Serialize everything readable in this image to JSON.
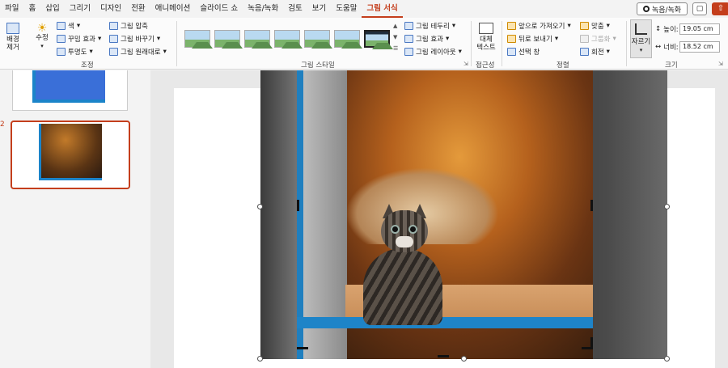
{
  "menu": {
    "items": [
      "파일",
      "홈",
      "삽입",
      "그리기",
      "디자인",
      "전환",
      "애니메이션",
      "슬라이드 쇼",
      "녹음/녹화",
      "검토",
      "보기",
      "도움말",
      "그림 서식"
    ],
    "record_button": "녹음/녹화",
    "accent_color": "#c43e1c"
  },
  "ribbon": {
    "adjust": {
      "remove_bg": "배경\n제거",
      "corrections": "수정",
      "color": "색",
      "artistic": "꾸밈 효과",
      "transparency": "투명도",
      "compress": "그림 압축",
      "change": "그림 바꾸기",
      "reset": "그림 원래대로",
      "group_label": "조정"
    },
    "styles": {
      "group_label": "그림 스타일",
      "border": "그림 테두리",
      "effects": "그림 효과",
      "layout": "그림 레이아웃"
    },
    "accessibility": {
      "alt_text": "대체\n텍스트",
      "group_label": "접근성"
    },
    "arrange": {
      "bring_forward": "앞으로 가져오기",
      "send_backward": "뒤로 보내기",
      "selection_pane": "선택 창",
      "align": "맞춤",
      "group": "그룹화",
      "rotate": "회전",
      "group_label": "정렬"
    },
    "size": {
      "crop": "자르기",
      "height_label": "높이:",
      "height_value": "19.05 cm",
      "width_label": "너비:",
      "width_value": "18.52 cm",
      "group_label": "크기"
    }
  },
  "thumbnails": {
    "current_slide_number": "2"
  }
}
